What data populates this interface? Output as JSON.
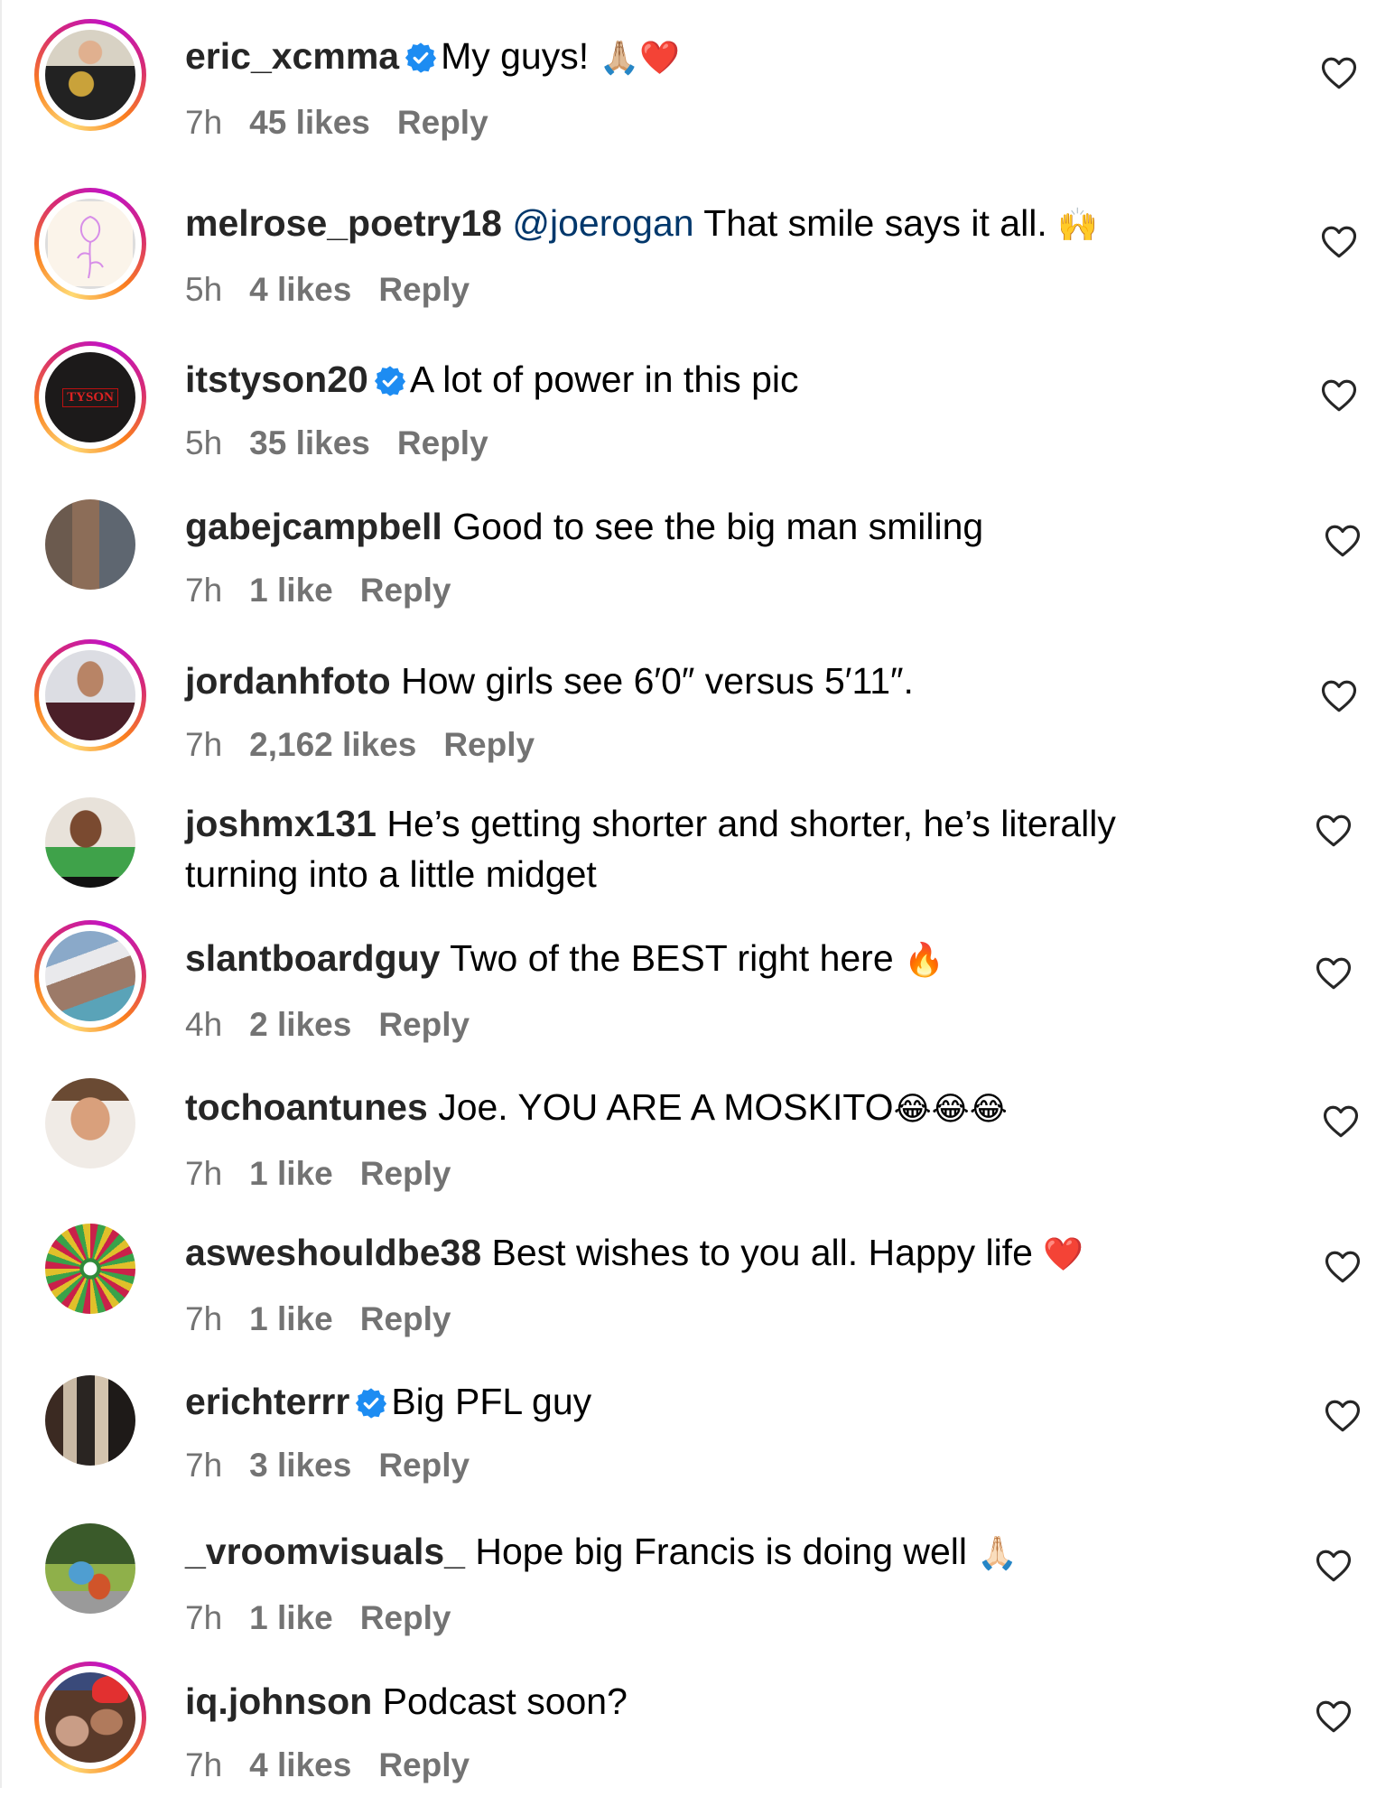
{
  "colors": {
    "username": "#262626",
    "text": "#000000",
    "meta": "#737373",
    "mention": "#00376b",
    "verified_badge": "#1d8cf2"
  },
  "comments": [
    {
      "username": "eric_xcmma",
      "verified": true,
      "text": "My guys! ",
      "emoji": "🙏🏼❤️",
      "time": "7h",
      "likes": "45 likes",
      "reply": "Reply",
      "avatar_ring": true,
      "avatar": "man-holding-championship-belt"
    },
    {
      "username": "melrose_poetry18",
      "verified": false,
      "mention": "@joerogan",
      "text": " That smile says it all. ",
      "emoji": "🙌",
      "time": "5h",
      "likes": "4 likes",
      "reply": "Reply",
      "avatar_ring": true,
      "avatar": "rose-drawing-logo"
    },
    {
      "username": "itstyson20",
      "verified": true,
      "text": "A lot of power in this pic",
      "time": "5h",
      "likes": "35 likes",
      "reply": "Reply",
      "avatar_ring": true,
      "avatar": "tyson-logo",
      "avatar_label": "TYSON"
    },
    {
      "username": "gabejcampbell",
      "verified": false,
      "text": "Good to see the big man smiling",
      "time": "7h",
      "likes": "1 like",
      "reply": "Reply",
      "avatar_ring": false,
      "avatar": "man-on-street"
    },
    {
      "username": "jordanhfoto",
      "verified": false,
      "text": "How girls see 6′0″ versus 5′11″.",
      "time": "7h",
      "likes": "2,162 likes",
      "reply": "Reply",
      "avatar_ring": true,
      "avatar": "man-portrait"
    },
    {
      "username": "joshmx131",
      "verified": false,
      "text": "He’s getting shorter and shorter, he’s literally turning into a little midget",
      "avatar_ring": false,
      "avatar": "man-green-shirt"
    },
    {
      "username": "slantboardguy",
      "verified": false,
      "text": "Two of the BEST right here ",
      "emoji": "🔥",
      "time": "4h",
      "likes": "2 likes",
      "reply": "Reply",
      "avatar_ring": true,
      "avatar": "selfie-outdoors"
    },
    {
      "username": "tochoantunes",
      "verified": false,
      "text": "Joe. YOU ARE A MOSKITO",
      "emoji": "😂😂😂",
      "time": "7h",
      "likes": "1 like",
      "reply": "Reply",
      "avatar_ring": false,
      "avatar": "smiling-man"
    },
    {
      "username": "asweshouldbe38",
      "verified": false,
      "text": "Best wishes to you all. Happy life ",
      "emoji": "❤️",
      "time": "7h",
      "likes": "1 like",
      "reply": "Reply",
      "avatar_ring": false,
      "avatar": "eye-mandala"
    },
    {
      "username": "erichterrr",
      "verified": true,
      "text": "Big PFL guy",
      "time": "7h",
      "likes": "3 likes",
      "reply": "Reply",
      "avatar_ring": false,
      "avatar": "group-photo"
    },
    {
      "username": "_vroomvisuals_",
      "verified": false,
      "text": "Hope big Francis is doing well ",
      "emoji": "🙏🏻",
      "time": "7h",
      "likes": "1 like",
      "reply": "Reply",
      "avatar_ring": false,
      "avatar": "motorcycle-rider"
    },
    {
      "username": "iq.johnson",
      "verified": false,
      "text": "Podcast soon?",
      "time": "7h",
      "likes": "4 likes",
      "reply": "Reply",
      "avatar_ring": true,
      "avatar": "two-people-selfie"
    }
  ],
  "icons": {
    "like": "heart-outline-icon",
    "verified": "verified-badge-icon"
  }
}
